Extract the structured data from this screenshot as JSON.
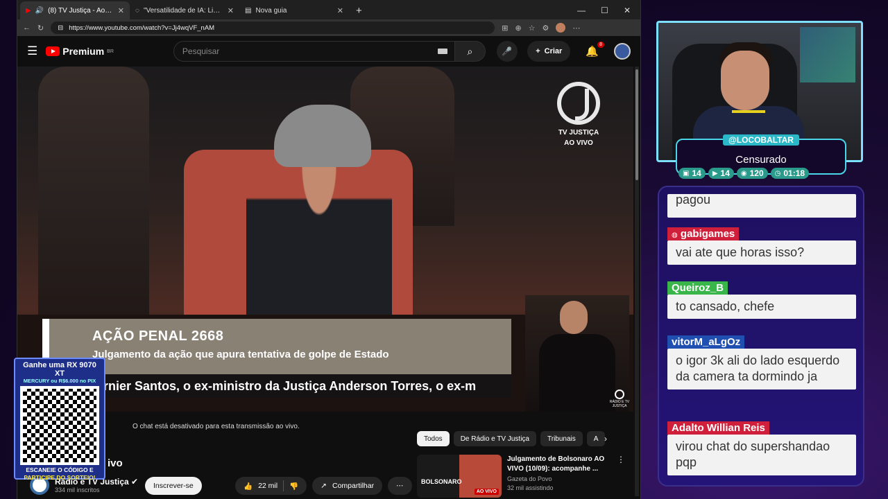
{
  "browser": {
    "tabs": [
      {
        "label": "(8) TV Justiça - Ao vivo - YouTube",
        "active": true
      },
      {
        "label": "\"Versatilidade de IA: Limitações e",
        "active": false
      },
      {
        "label": "Nova guia",
        "active": false
      }
    ],
    "url": "https://www.youtube.com/watch?v=Jj4wqVF_nAM"
  },
  "youtube": {
    "logo": "Premium",
    "region": "BR",
    "search_placeholder": "Pesquisar",
    "create_label": "Criar",
    "notif_count": "8"
  },
  "video": {
    "channel_logo_line1": "TV JUSTIÇA",
    "channel_logo_line2": "AO VIVO",
    "lower_third_title": "AÇÃO PENAL 2668",
    "lower_third_sub": "Julgamento da ação que apura tentativa de golpe de Estado",
    "ticker": "rnier Santos, o ex-ministro da Justiça Anderson Torres, o ex-m",
    "watermark": "RÁDIO E TV JUSTIÇA"
  },
  "below": {
    "chat_disabled": "O chat está desativado para esta transmissão ao vivo.",
    "title_fragment": "ivo",
    "channel_name": "Rádio e TV Justiça",
    "subscribers": "334 mil inscritos",
    "subscribe_label": "Inscrever-se",
    "likes": "22 mil",
    "share_label": "Compartilhar",
    "chips": [
      "Todos",
      "De Rádio e TV Justiça",
      "Tribunais",
      "A"
    ],
    "rec": {
      "title": "Julgamento de Bolsonaro AO VIVO (10/09): acompanhe ...",
      "channel": "Gazeta do Povo",
      "views": "32 mil assistindo",
      "thumb_text": "BOLSONARO",
      "thumb_badge": "AO VIVO"
    }
  },
  "qr": {
    "top1": "Ganhe uma RX 9070 XT",
    "top2": "MERCURY ou R$6.000 no PIX",
    "bottom1": "ESCANEIE O CÓDIGO E",
    "bottom2": "PARTICIPE DO SORTEIO!"
  },
  "stream": {
    "handle": "@LOCOBALTAR",
    "status": "Censurado",
    "stats": [
      {
        "icon": "twitch-icon",
        "value": "14"
      },
      {
        "icon": "youtube-icon",
        "value": "14"
      },
      {
        "icon": "eye-icon",
        "value": "120"
      },
      {
        "icon": "clock-icon",
        "value": "01:18"
      }
    ]
  },
  "chat": [
    {
      "user": "",
      "text": "pagou",
      "color": "#e0223a"
    },
    {
      "user": "gabigames",
      "text": "vai ate que horas isso?",
      "color": "#d01f3a"
    },
    {
      "user": "Queiroz_B",
      "text": "to cansado, chefe",
      "color": "#3ab54a"
    },
    {
      "user": "vitorM_aLgOz",
      "text": "o igor 3k ali do lado esquerdo da camera ta dormindo ja",
      "color": "#1f4fb0"
    },
    {
      "user": "Adalto Willian Reis",
      "text": "virou chat do supershandao pqp",
      "color": "#d01f3a"
    }
  ]
}
